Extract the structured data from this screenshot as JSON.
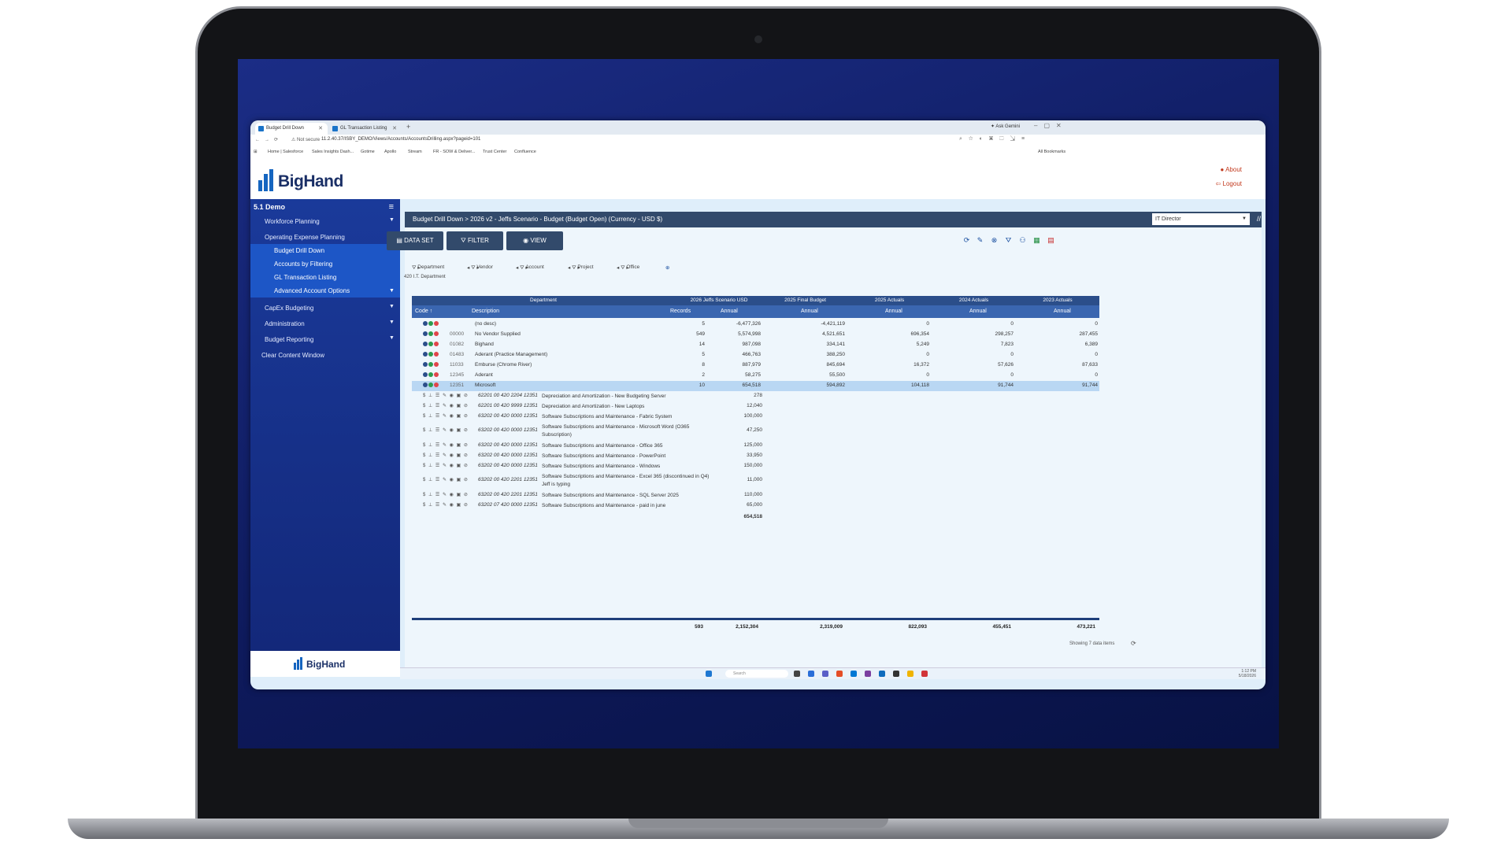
{
  "browser": {
    "tabs": [
      {
        "title": "Budget Drill Down"
      },
      {
        "title": "GL Transaction Listing"
      }
    ],
    "url": "11.2.40.37/ISBY_DEMO/Views/Accounts/AccountsDrilling.aspx?pageid=101",
    "not_secure": "Not secure",
    "ask_gemini": "Ask Gemini",
    "bookmarks": [
      "Home | Salesforce",
      "Sales Insights Dash...",
      "Gotime",
      "Apollo",
      "Stream",
      "FR - SOW & Deliver...",
      "Trust Center",
      "Confluence"
    ],
    "all_bookmarks": "All Bookmarks"
  },
  "app": {
    "logo_text": "BigHand",
    "about": "About",
    "logout": "Logout"
  },
  "sidebar": {
    "title": "5.1 Demo",
    "items": [
      {
        "label": "Workforce Planning"
      },
      {
        "label": "Operating Expense Planning"
      },
      {
        "label": "CapEx Budgeting"
      },
      {
        "label": "Administration"
      },
      {
        "label": "Budget Reporting"
      },
      {
        "label": "Clear Content Window"
      }
    ],
    "subitems": [
      {
        "label": "Budget Drill Down"
      },
      {
        "label": "Accounts by Filtering"
      },
      {
        "label": "GL Transaction Listing"
      },
      {
        "label": "Advanced Account Options"
      }
    ],
    "footer_logo": "BigHand"
  },
  "breadcrumb": "Budget Drill Down > 2026 v2 - Jeffs Scenario - Budget (Budget Open) (Currency - USD $)",
  "role_select": "IT Director",
  "toolbar": {
    "dataset": "DATA SET",
    "filter": "FILTER",
    "view": "VIEW"
  },
  "filters": {
    "items": [
      "Department",
      "Vendor",
      "Account",
      "Project",
      "Office"
    ],
    "selection": "420   I.T. Department"
  },
  "grid": {
    "group_headers": [
      "Department",
      "2026 Jeffs Scenario USD",
      "2025 Final Budget",
      "2025 Actuals",
      "2024 Actuals",
      "2023 Actuals"
    ],
    "columns": [
      "Code",
      "Description",
      "Records",
      "Annual",
      "Annual",
      "Annual",
      "Annual",
      "Annual"
    ],
    "rows": [
      {
        "code": "",
        "desc": "(no desc)",
        "records": "5",
        "a2026": "-6,477,326",
        "a2025b": "-4,421,119",
        "a2025": "0",
        "a2024": "0",
        "a2023": "0"
      },
      {
        "code": "00000",
        "desc": "No Vendor Supplied",
        "records": "549",
        "a2026": "5,574,998",
        "a2025b": "4,521,651",
        "a2025": "696,354",
        "a2024": "298,257",
        "a2023": "287,455"
      },
      {
        "code": "01082",
        "desc": "Bighand",
        "records": "14",
        "a2026": "987,098",
        "a2025b": "334,141",
        "a2025": "5,249",
        "a2024": "7,823",
        "a2023": "6,389"
      },
      {
        "code": "01483",
        "desc": "Aderant (Practice Management)",
        "records": "5",
        "a2026": "466,763",
        "a2025b": "388,250",
        "a2025": "0",
        "a2024": "0",
        "a2023": "0"
      },
      {
        "code": "11033",
        "desc": "Emburse (Chrome River)",
        "records": "8",
        "a2026": "887,979",
        "a2025b": "845,694",
        "a2025": "16,372",
        "a2024": "57,626",
        "a2023": "87,633"
      },
      {
        "code": "12345",
        "desc": "Aderant",
        "records": "2",
        "a2026": "58,275",
        "a2025b": "55,500",
        "a2025": "0",
        "a2024": "0",
        "a2023": "0"
      },
      {
        "code": "12351",
        "desc": "Microsoft",
        "records": "10",
        "a2026": "654,518",
        "a2025b": "594,892",
        "a2025": "104,118",
        "a2024": "91,744",
        "a2023": "91,744"
      }
    ],
    "details": [
      {
        "acct": "62201 00 420 2204 12351",
        "desc": "Depreciation and Amortization - New Budgeting Server",
        "amt": "278"
      },
      {
        "acct": "62201 00 420 9999 12351",
        "desc": "Depreciation and Amortization - New Laptops",
        "amt": "12,040"
      },
      {
        "acct": "63202 00 420 0000 12351",
        "desc": "Software Subscriptions and Maintenance - Fabric System",
        "amt": "100,000"
      },
      {
        "acct": "63202 00 420 0000 12351",
        "desc": "Software Subscriptions and Maintenance - Microsoft Word (O365 Subscription)",
        "amt": "47,250"
      },
      {
        "acct": "63202 00 420 0000 12351",
        "desc": "Software Subscriptions and Maintenance - Office 365",
        "amt": "125,000"
      },
      {
        "acct": "63202 00 420 0000 12351",
        "desc": "Software Subscriptions and Maintenance - PowerPoint",
        "amt": "33,950"
      },
      {
        "acct": "63202 00 420 0000 12351",
        "desc": "Software Subscriptions and Maintenance - Windows",
        "amt": "150,000"
      },
      {
        "acct": "63202 00 420 2201 12351",
        "desc": "Software Subscriptions and Maintenance - Excel 365 (discontinued in Q4) Jeff is typing",
        "amt": "11,000"
      },
      {
        "acct": "63202 00 420 2201 12351",
        "desc": "Software Subscriptions and Maintenance - SQL Server 2025",
        "amt": "110,000"
      },
      {
        "acct": "63202 07 420 0000 12351",
        "desc": "Software Subscriptions and Maintenance - paid in june",
        "amt": "65,000"
      }
    ],
    "detail_total": "654,518",
    "totals": {
      "records": "593",
      "a2026": "2,152,304",
      "a2025b": "2,319,009",
      "a2025": "822,093",
      "a2024": "455,451",
      "a2023": "473,221"
    },
    "showing": "Showing 7 data items"
  },
  "taskbar": {
    "search": "Search",
    "time": "1:12 PM",
    "date": "5/18/2026"
  },
  "colors": {
    "header_dark": "#324a6b",
    "grid_header": "#3a66b0",
    "sidebar": "#1a3a9a",
    "selected_row": "#b9d7f3",
    "accent_red": "#c23a1e"
  }
}
